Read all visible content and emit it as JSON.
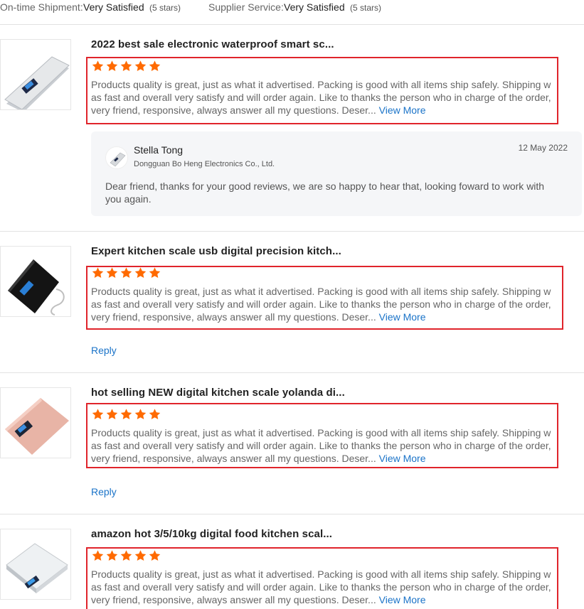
{
  "ratings": {
    "shipment_label": "On-time Shipment:",
    "shipment_value": "Very Satisfied",
    "shipment_stars": "(5 stars)",
    "service_label": "Supplier Service:",
    "service_value": "Very Satisfied",
    "service_stars": "(5 stars)"
  },
  "colors": {
    "star": "#ff6a00",
    "highlight": "#e0242b",
    "link": "#1a73c8"
  },
  "reviews": [
    {
      "title": "2022 best sale electronic waterproof smart sc...",
      "thumb_icon": "silver-kitchen-scale-image",
      "rating": 5,
      "text": "Products quality is great, just as what it advertised. Packing is good with all items ship safely. Shipping was fast and overall very satisfy and will order again. Like to thanks the person who in charge of the order, very friend, responsive, always answer all my questions. Deser...",
      "view_more": "View More",
      "supplier_reply": {
        "name": "Stella Tong",
        "company": "Dongguan Bo Heng Electronics Co., Ltd.",
        "date": "12 May 2022",
        "message": "Dear friend, thanks for your good reviews, we are so happy to hear that, looking foward to work with you again."
      }
    },
    {
      "title": "Expert kitchen scale usb digital precision kitch...",
      "thumb_icon": "black-usb-kitchen-scale-image",
      "rating": 5,
      "text": "Products quality is great, just as what it advertised. Packing is good with all items ship safely. Shipping was fast and overall very satisfy and will order again. Like to thanks the person who in charge of the order, very friend, responsive, always answer all my questions. Deser...",
      "view_more": "View More",
      "reply_label": "Reply"
    },
    {
      "title": "hot selling NEW digital kitchen scale yolanda di...",
      "thumb_icon": "pink-kitchen-scale-image",
      "rating": 5,
      "text": "Products quality is great, just as what it advertised. Packing is good with all items ship safely. Shipping was fast and overall very satisfy and will order again. Like to thanks the person who in charge of the order, very friend, responsive, always answer all my questions. Deser...",
      "view_more": "View More",
      "reply_label": "Reply"
    },
    {
      "title": "amazon hot 3/5/10kg digital food kitchen scal...",
      "thumb_icon": "white-kitchen-scale-image",
      "rating": 5,
      "text": "Products quality is great, just as what it advertised. Packing is good with all items ship safely. Shipping was fast and overall very satisfy and will order again. Like to thanks the person who in charge of the order, very friend, responsive, always answer all my questions. Deser...",
      "view_more": "View More"
    }
  ]
}
